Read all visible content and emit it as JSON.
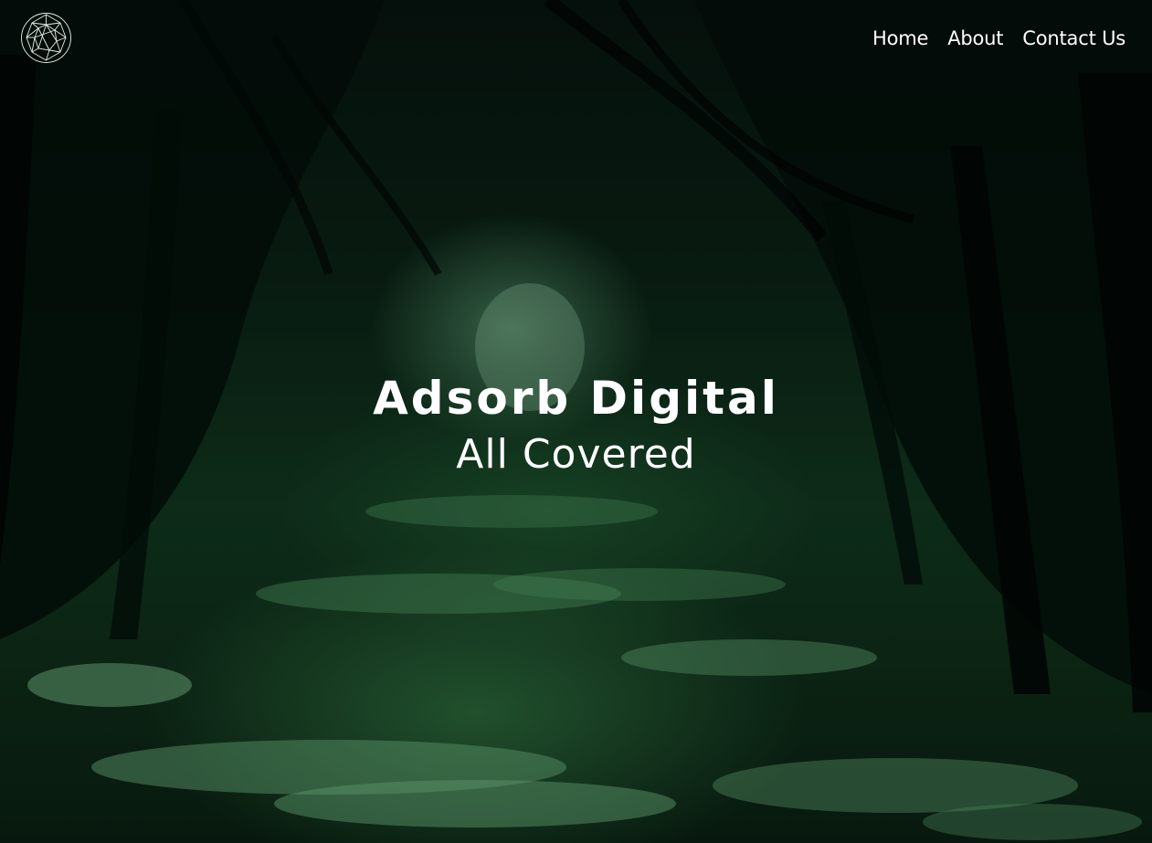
{
  "nav": {
    "items": [
      {
        "label": "Home"
      },
      {
        "label": "About"
      },
      {
        "label": "Contact Us"
      }
    ]
  },
  "hero": {
    "title": "Adsorb Digital",
    "subtitle": "All Covered"
  },
  "logo": {
    "icon": "geodesic-sphere-icon"
  },
  "colors": {
    "text": "#ffffff",
    "background_dark": "#071510",
    "background_green": "#123a21"
  }
}
